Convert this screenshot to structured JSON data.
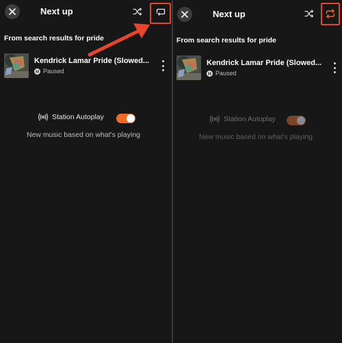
{
  "left_panel": {
    "title": "Next up",
    "source_label": "From search results for pride",
    "track": {
      "title": "Kendrick Lamar Pride (Slowed...",
      "status": "Paused"
    },
    "autoplay": {
      "label": "Station Autoplay",
      "enabled": true,
      "description": "New music based on what's playing"
    },
    "repeat_state": "off"
  },
  "right_panel": {
    "title": "Next up",
    "source_label": "From search results for pride",
    "track": {
      "title": "Kendrick Lamar Pride (Slowed...",
      "status": "Paused"
    },
    "autoplay": {
      "label": "Station Autoplay",
      "enabled": false,
      "description": "New music based on what's playing"
    },
    "repeat_state": "on"
  },
  "icons": {
    "close": "close-icon",
    "shuffle": "shuffle-icon",
    "repeat": "repeat-icon",
    "pause": "pause-icon",
    "more": "more-vertical-icon",
    "broadcast": "broadcast-icon"
  },
  "colors": {
    "background": "#171717",
    "accent": "#f06a23",
    "highlight": "#e8452c",
    "repeat_active": "#f06a23"
  }
}
